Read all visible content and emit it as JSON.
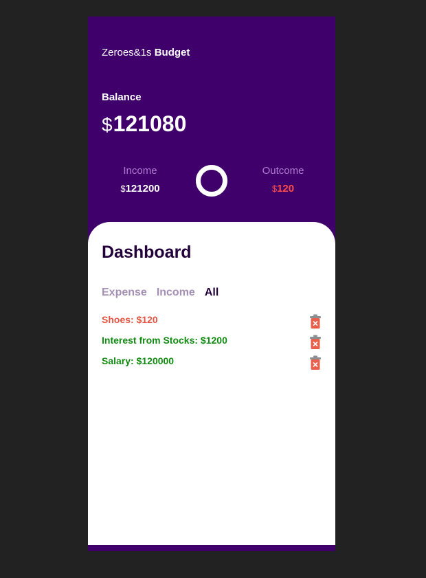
{
  "app": {
    "brand_prefix": "Zeroes&1s",
    "brand_name": "Budget"
  },
  "balance": {
    "label": "Balance",
    "currency": "$",
    "value": "121080"
  },
  "income": {
    "label": "Income",
    "currency": "$",
    "value": "121200"
  },
  "outcome": {
    "label": "Outcome",
    "currency": "$",
    "value": "120"
  },
  "ring": {
    "income_fraction": 0.999,
    "outcome_fraction": 0.001
  },
  "dashboard": {
    "title": "Dashboard",
    "tabs": [
      {
        "label": "Expense",
        "active": false
      },
      {
        "label": "Income",
        "active": false
      },
      {
        "label": "All",
        "active": true
      }
    ],
    "transactions": [
      {
        "text": "Shoes: $120",
        "type": "expense"
      },
      {
        "text": "Interest from Stocks: $1200",
        "type": "income"
      },
      {
        "text": "Salary: $120000",
        "type": "income"
      }
    ]
  },
  "colors": {
    "header_bg": "#3f006b",
    "expense": "#e5523f",
    "income": "#118a11",
    "outcome_value": "#ff4a4a",
    "delete_icon": "#e8604c"
  }
}
